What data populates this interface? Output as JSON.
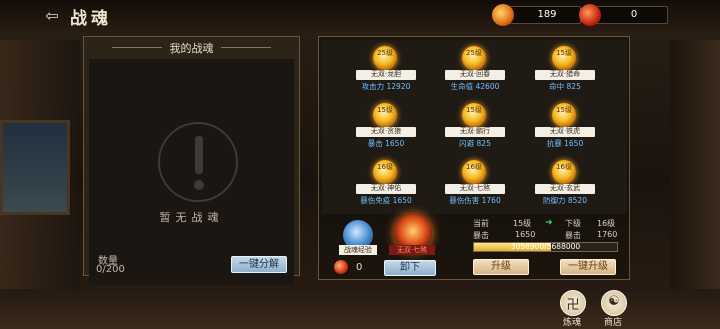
{
  "header": {
    "back_glyph": "⇦",
    "title": "战魂",
    "resources": [
      {
        "icon": "soul-fire-icon",
        "value": "189"
      },
      {
        "icon": "fragment-icon",
        "value": "0"
      }
    ]
  },
  "left_panel": {
    "title": "我的战魂",
    "empty_text": "暂无战魂",
    "qty_label": "数量",
    "qty_value": "0/200",
    "decompose_button": "一键分解"
  },
  "souls": [
    {
      "level": "25级",
      "name": "无双·龙胆",
      "stat": "攻击力 12920"
    },
    {
      "level": "25级",
      "name": "无双·回春",
      "stat": "生命值 42600"
    },
    {
      "level": "15级",
      "name": "无双·猎命",
      "stat": "命中 825"
    },
    {
      "level": "15级",
      "name": "无双·贪狼",
      "stat": "暴击 1650"
    },
    {
      "level": "15级",
      "name": "无双·鹏行",
      "stat": "闪避 825"
    },
    {
      "level": "15级",
      "name": "无双·铁虎",
      "stat": "抗暴 1650"
    },
    {
      "level": "16级",
      "name": "无双·神佑",
      "stat": "暴伤免疫 1650"
    },
    {
      "level": "16级",
      "name": "无双·七煞",
      "stat": "暴伤伤害 1760"
    },
    {
      "level": "16级",
      "name": "无双·玄武",
      "stat": "防御力 8520"
    }
  ],
  "bottom": {
    "exp_label": "战魂经验",
    "current_name": "无双·七煞",
    "fragment_count": "0",
    "unload_button": "卸下",
    "current_label": "当前",
    "current_level": "15级",
    "next_label": "下级",
    "next_level": "16级",
    "stat_name": "暴击",
    "current_stat": "1650",
    "next_stat": "1760",
    "exp_text": "3058900/5688000",
    "exp_fraction": 0.54,
    "upgrade_button": "升级",
    "oneclick_upgrade_button": "一键升级",
    "arrow": "➜"
  },
  "side_buttons": [
    {
      "label": "炼魂",
      "icon": "refine-soul-icon",
      "glyph": "卍"
    },
    {
      "label": "商店",
      "icon": "shop-icon",
      "glyph": "☯"
    }
  ]
}
